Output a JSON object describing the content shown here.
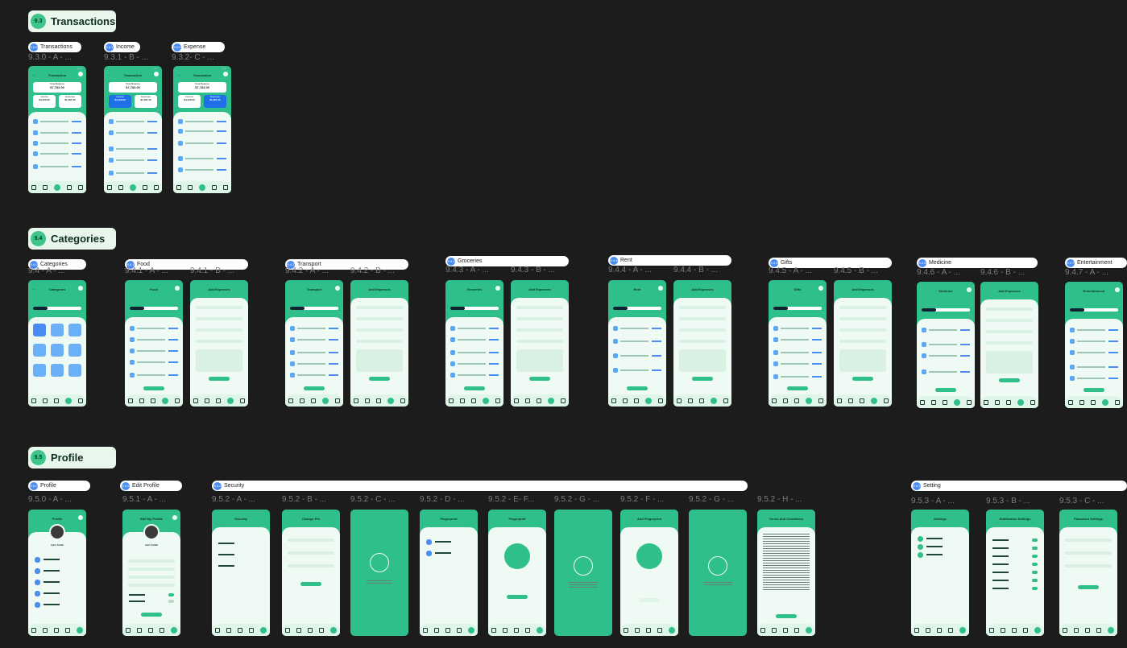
{
  "sections": [
    {
      "num": "9.3",
      "title": "Transactions"
    },
    {
      "num": "9.4",
      "title": "Categories"
    },
    {
      "num": "9.5",
      "title": "Profile"
    }
  ],
  "groups": {
    "transactions": [
      {
        "num": "9.3.0",
        "title": "Transactions"
      },
      {
        "num": "9.3.1",
        "title": "Income"
      },
      {
        "num": "9.3.2",
        "title": "Expense"
      }
    ],
    "categories": [
      {
        "num": "9.4.0",
        "title": "Categories"
      },
      {
        "num": "9.4.1",
        "title": "Food"
      },
      {
        "num": "9.4.2",
        "title": "Transport"
      },
      {
        "num": "9.4.3",
        "title": "Groceries"
      },
      {
        "num": "9.4.4",
        "title": "Rent"
      },
      {
        "num": "9.4.5",
        "title": "Gifts"
      },
      {
        "num": "9.4.6",
        "title": "Medicine"
      },
      {
        "num": "9.4.7",
        "title": "Entertainment"
      }
    ],
    "profile": [
      {
        "num": "9.5.0",
        "title": "Profile"
      },
      {
        "num": "9.5.1",
        "title": "Edit Profile"
      },
      {
        "num": "9.5.2",
        "title": "Security"
      },
      {
        "num": "9.5.3",
        "title": "Setting"
      }
    ]
  },
  "frame_labels": {
    "t0": "9.3.0 - A - ...",
    "t1": "9.3.1 - B - ...",
    "t2": "9.3.2- C - ...",
    "c0": "9.4 - A - ...",
    "c1a": "9.4.1 - A - ...",
    "c1b": "9.4.1 - B - ...",
    "c2a": "9.4.2 - A - ...",
    "c2b": "9.4.2 - B - ...",
    "c3a": "9.4.3 - A - ...",
    "c3b": "9.4.3 - B - ...",
    "c4a": "9.4.4 - A - ...",
    "c4b": "9.4.4 - B - ...",
    "c5a": "9.4.5 - A - ...",
    "c5b": "9.4.5 - B - ...",
    "c6a": "9.4.6 - A - ...",
    "c6b": "9.4.6 - B - ...",
    "c7a": "9.4.7 - A - ...",
    "p0": "9.5.0 - A - ...",
    "p1": "9.5.1 - A - ...",
    "p2a": "9.5.2 - A - ...",
    "p2b": "9.5.2 - B - ...",
    "p2c": "9.5.2 - C - ...",
    "p2d": "9.5.2 - D - ...",
    "p2e": "9.5.2 - E- F...",
    "p2g": "9.5.2 - G - ...",
    "p2f": "9.5.2 - F - ...",
    "p2g2": "9.5.2 - G - ...",
    "p2h": "9.5.2 - H - ...",
    "p3a": "9.5.3 - A - ...",
    "p3b": "9.5.3 - B - ...",
    "p3c": "9.5.3 - C - ..."
  },
  "screens": {
    "transactions": "Transaction",
    "total_balance_label": "Total Balance",
    "total_balance": "$7,783.00",
    "income_label": "Income",
    "income": "$4,120.00",
    "expense_label": "Expense",
    "expense": "$1,187.40",
    "categories": "Categories",
    "food": "Food",
    "add_expenses": "Add Expenses",
    "transport": "Transport",
    "groceries": "Groceries",
    "rent": "Rent",
    "gifts": "Gifts",
    "medicine": "Medicine",
    "entertainment": "Entertainment",
    "profile": "Profile",
    "edit_profile": "Edit My Profile",
    "user_name": "John Smith",
    "security": "Security",
    "change_pin": "Change Pin",
    "fingerprint": "Fingerprint",
    "add_fingerprint": "Add Fingerprint",
    "terms": "Terms And Conditions",
    "settings": "Settings",
    "notification_settings": "Notification Settings",
    "password_settings": "Password Settings"
  },
  "colors": {
    "background": "#1c1c1c",
    "brand_green": "#2fbf8a",
    "surface": "#eefaf3",
    "accent_blue": "#4a8cf2"
  }
}
